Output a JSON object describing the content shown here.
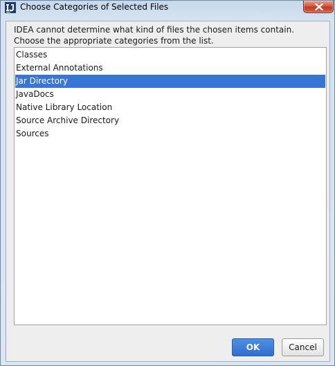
{
  "window": {
    "title": "Choose Categories of Selected Files"
  },
  "message": {
    "line1": "IDEA cannot determine what kind of files the chosen items contain.",
    "line2": "Choose the appropriate categories from the list."
  },
  "categories": {
    "items": [
      {
        "label": "Classes",
        "selected": false
      },
      {
        "label": "External Annotations",
        "selected": false
      },
      {
        "label": "Jar Directory",
        "selected": true
      },
      {
        "label": "JavaDocs",
        "selected": false
      },
      {
        "label": "Native Library Location",
        "selected": false
      },
      {
        "label": "Source Archive Directory",
        "selected": false
      },
      {
        "label": "Sources",
        "selected": false
      }
    ]
  },
  "buttons": {
    "ok_label": "OK",
    "cancel_label": "Cancel"
  },
  "colors": {
    "selection": "#3875d7",
    "ok_button": "#3a78d8",
    "close_button": "#c94a31"
  },
  "icons": {
    "app": "intellij-idea-icon",
    "close": "close-icon"
  }
}
